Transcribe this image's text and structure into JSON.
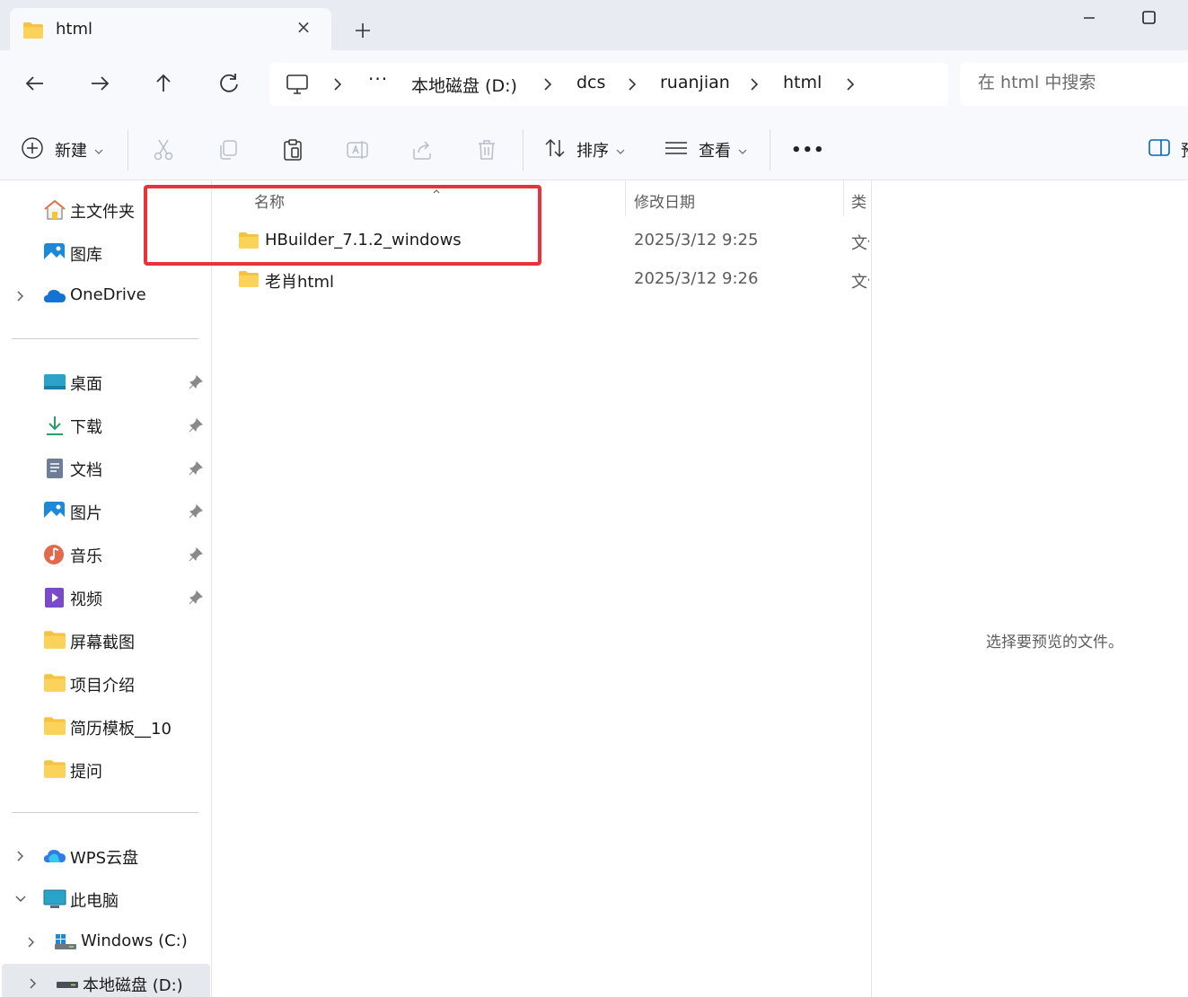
{
  "tab": {
    "title": "html",
    "close": "×",
    "folder_icon": "folder-icon"
  },
  "window": {
    "minimize_icon": "minimize-icon",
    "maximize_icon": "maximize-icon"
  },
  "address": {
    "more": "···",
    "crumbs": [
      "本地磁盘 (D:)",
      "dcs",
      "ruanjian",
      "html"
    ]
  },
  "search": {
    "placeholder": "在 html 中搜索"
  },
  "toolbar": {
    "new_label": "新建",
    "sort_label": "排序",
    "view_label": "查看",
    "more_label": "•••",
    "preview_label": "预"
  },
  "sidebar": {
    "quick": [
      {
        "label": "主文件夹",
        "icon": "home-icon"
      },
      {
        "label": "图库",
        "icon": "gallery-icon"
      },
      {
        "label": "OneDrive",
        "icon": "cloud-icon"
      }
    ],
    "pinned": [
      {
        "label": "桌面",
        "icon": "desktop-icon"
      },
      {
        "label": "下载",
        "icon": "download-icon"
      },
      {
        "label": "文档",
        "icon": "document-icon"
      },
      {
        "label": "图片",
        "icon": "pictures-icon"
      },
      {
        "label": "音乐",
        "icon": "music-icon"
      },
      {
        "label": "视频",
        "icon": "video-icon"
      },
      {
        "label": "屏幕截图",
        "icon": "folder-icon"
      },
      {
        "label": "项目介绍",
        "icon": "folder-icon"
      },
      {
        "label": "简历模板__10",
        "icon": "folder-icon"
      },
      {
        "label": "提问",
        "icon": "folder-icon"
      }
    ],
    "devices": [
      {
        "label": "WPS云盘",
        "icon": "wps-cloud-icon"
      },
      {
        "label": "此电脑",
        "icon": "this-pc-icon"
      },
      {
        "label": "Windows (C:)",
        "icon": "drive-icon"
      },
      {
        "label": "本地磁盘 (D:)",
        "icon": "drive-icon"
      }
    ]
  },
  "list": {
    "columns": {
      "name": "名称",
      "modified": "修改日期",
      "type": "类"
    },
    "rows": [
      {
        "name": "HBuilder_7.1.2_windows",
        "modified": "2025/3/12 9:25",
        "type": "文件夹"
      },
      {
        "name": "老肖html",
        "modified": "2025/3/12 9:26",
        "type": "文件夹"
      }
    ]
  },
  "preview": {
    "message": "选择要预览的文件。"
  },
  "colors": {
    "highlight": "#e8323c",
    "folder": "#f5c342",
    "accent": "#0067c0"
  }
}
